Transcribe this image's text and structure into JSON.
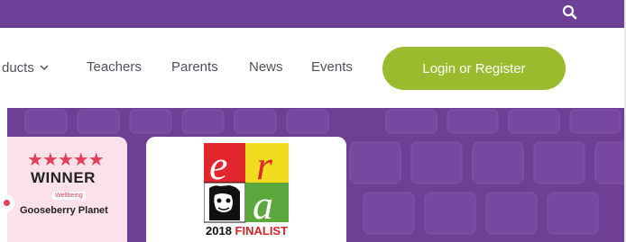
{
  "topbar": {
    "search_icon": "search-icon",
    "background": "#6e3f96"
  },
  "nav": {
    "items": [
      "ducts",
      "Teachers",
      "Parents",
      "News",
      "Events"
    ],
    "products_chevron": "⌄",
    "login_label": "Login or Register",
    "login_color": "#9bbb2e"
  },
  "cards": {
    "winner": {
      "stars": "★★★★★",
      "title": "WINNER",
      "category": "Wellbeing",
      "product": "Gooseberry Planet"
    },
    "era": {
      "year": "2018",
      "label": "FINALIST",
      "letters": [
        "e",
        "r",
        "a"
      ]
    }
  }
}
